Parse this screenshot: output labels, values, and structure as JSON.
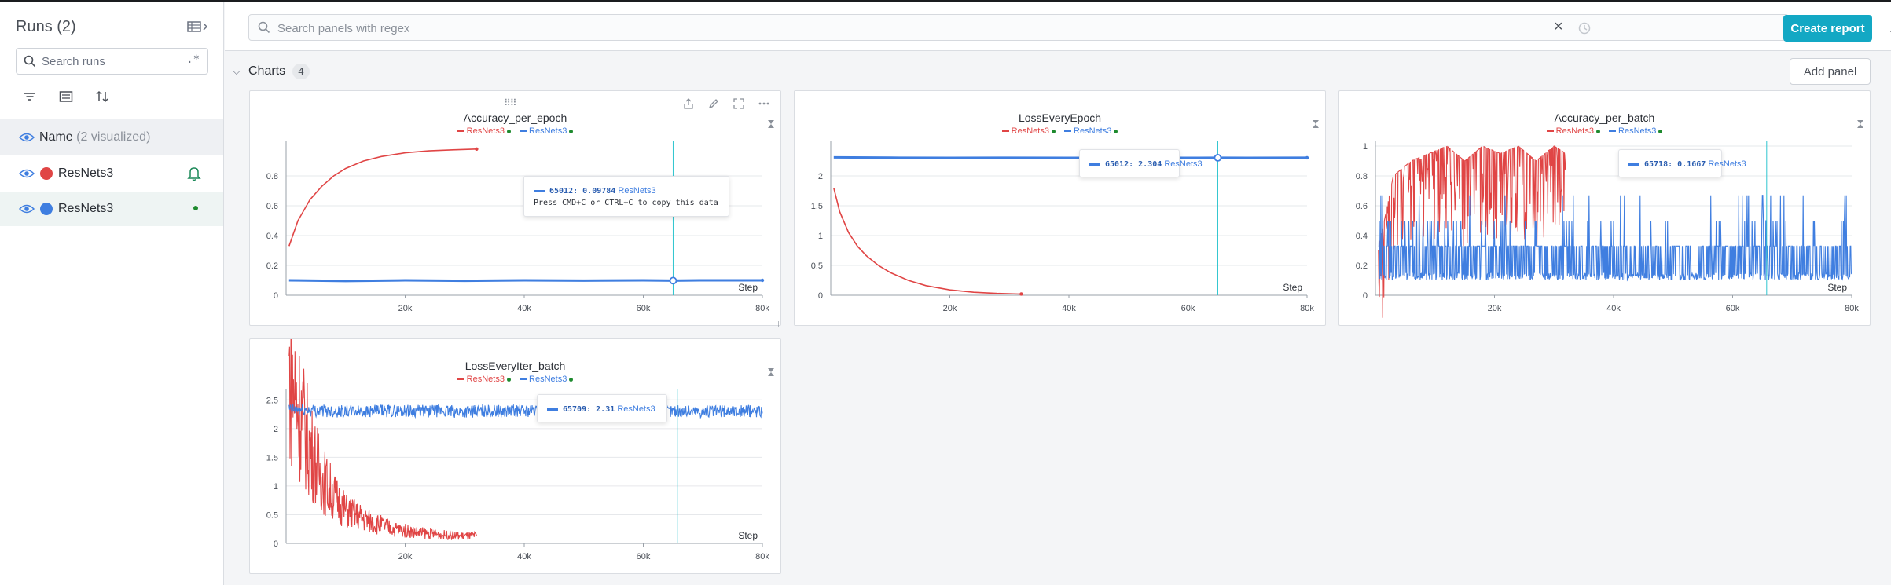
{
  "colors": {
    "accent": "#13a8c4",
    "run_red": "#e04545",
    "run_blue": "#3f7ee0",
    "status_green": "#1e8a2e",
    "cursor": "#2ec5cf"
  },
  "sidebar": {
    "title": "Runs (2)",
    "search_placeholder": "Search runs",
    "regex_label": ".*",
    "header_label": "Name",
    "header_count": "(2 visualized)",
    "runs": [
      {
        "name": "ResNets3",
        "color": "#e04545",
        "indicator": "bell-icon"
      },
      {
        "name": "ResNets3",
        "color": "#3f7ee0",
        "indicator": "green-dot"
      }
    ]
  },
  "topbar": {
    "search_placeholder": "Search panels with regex",
    "create_report_label": "Create report"
  },
  "section": {
    "title": "Charts",
    "count": "4",
    "add_panel_label": "Add panel"
  },
  "step_label": "Step",
  "legend_names": [
    "ResNets3",
    "ResNets3"
  ],
  "charts": [
    {
      "title": "Accuracy_per_epoch",
      "y_ticks": [
        "0",
        "0.2",
        "0.4",
        "0.6",
        "0.8"
      ],
      "x_ticks": [
        "20k",
        "40k",
        "60k",
        "80k"
      ],
      "tooltip": {
        "step": "65012",
        "value": "0.09784",
        "run": "ResNets3",
        "hint": "Press CMD+C or CTRL+C to copy this data"
      }
    },
    {
      "title": "LossEveryEpoch",
      "y_ticks": [
        "0",
        "0.5",
        "1",
        "1.5",
        "2"
      ],
      "x_ticks": [
        "20k",
        "40k",
        "60k",
        "80k"
      ],
      "tooltip": {
        "step": "65012",
        "value": "2.304",
        "run": "ResNets3"
      }
    },
    {
      "title": "Accuracy_per_batch",
      "y_ticks": [
        "0",
        "0.2",
        "0.4",
        "0.6",
        "0.8",
        "1"
      ],
      "x_ticks": [
        "20k",
        "40k",
        "60k",
        "80k"
      ],
      "tooltip": {
        "step": "65718",
        "value": "0.1667",
        "run": "ResNets3"
      }
    },
    {
      "title": "LossEveryIter_batch",
      "y_ticks": [
        "0",
        "0.5",
        "1",
        "1.5",
        "2",
        "2.5"
      ],
      "x_ticks": [
        "20k",
        "40k",
        "60k",
        "80k"
      ],
      "tooltip": {
        "step": "65709",
        "value": "2.31",
        "run": "ResNets3"
      }
    }
  ],
  "chart_data": [
    {
      "type": "line",
      "title": "Accuracy_per_epoch",
      "xlabel": "Step",
      "xlim": [
        0,
        80000
      ],
      "ylim": [
        0,
        1
      ],
      "series": [
        {
          "name": "ResNets3",
          "color": "#e04545",
          "x": [
            500,
            2000,
            4000,
            6000,
            8000,
            10000,
            13000,
            16000,
            20000,
            24000,
            28000,
            32000
          ],
          "y": [
            0.33,
            0.5,
            0.64,
            0.73,
            0.8,
            0.85,
            0.9,
            0.93,
            0.955,
            0.968,
            0.975,
            0.98
          ]
        },
        {
          "name": "ResNets3",
          "color": "#3f7ee0",
          "x": [
            500,
            10000,
            20000,
            30000,
            40000,
            50000,
            60000,
            65012,
            70000,
            80000
          ],
          "y": [
            0.1,
            0.095,
            0.1,
            0.097,
            0.1,
            0.098,
            0.1,
            0.09784,
            0.1,
            0.1
          ]
        }
      ]
    },
    {
      "type": "line",
      "title": "LossEveryEpoch",
      "xlabel": "Step",
      "xlim": [
        0,
        80000
      ],
      "ylim": [
        0,
        2.5
      ],
      "series": [
        {
          "name": "ResNets3",
          "color": "#e04545",
          "x": [
            500,
            1500,
            3000,
            4500,
            6000,
            8000,
            10000,
            13000,
            16000,
            20000,
            24000,
            28000,
            32000
          ],
          "y": [
            1.8,
            1.4,
            1.05,
            0.82,
            0.66,
            0.5,
            0.38,
            0.25,
            0.16,
            0.09,
            0.05,
            0.03,
            0.02
          ]
        },
        {
          "name": "ResNets3",
          "color": "#3f7ee0",
          "x": [
            500,
            10000,
            20000,
            30000,
            40000,
            50000,
            60000,
            65012,
            70000,
            80000
          ],
          "y": [
            2.31,
            2.305,
            2.303,
            2.304,
            2.303,
            2.304,
            2.303,
            2.304,
            2.303,
            2.304
          ]
        }
      ]
    },
    {
      "type": "line",
      "title": "Accuracy_per_batch",
      "xlabel": "Step",
      "xlim": [
        0,
        80000
      ],
      "ylim": [
        0,
        1
      ],
      "series": [
        {
          "name": "ResNets3",
          "color": "#e04545",
          "x": [
            500,
            3000,
            6000,
            9000,
            12000,
            15000,
            18000,
            21000,
            24000,
            27000,
            30000,
            32000
          ],
          "y": [
            0.3,
            0.8,
            0.9,
            0.95,
            1,
            0.9,
            1,
            0.95,
            1,
            0.9,
            1,
            0.95
          ]
        },
        {
          "name": "ResNets3",
          "color": "#3f7ee0",
          "x": [
            500,
            10000,
            20000,
            30000,
            40000,
            50000,
            60000,
            65718,
            70000,
            80000
          ],
          "y": [
            0.1,
            0.15,
            0.1,
            0.2,
            0.1,
            0.15,
            0.1,
            0.1667,
            0.1,
            0.15
          ]
        }
      ]
    },
    {
      "type": "line",
      "title": "LossEveryIter_batch",
      "xlabel": "Step",
      "xlim": [
        0,
        80000
      ],
      "ylim": [
        0,
        2.6
      ],
      "series": [
        {
          "name": "ResNets3",
          "color": "#e04545",
          "x": [
            500,
            2000,
            4000,
            6000,
            8000,
            10000,
            14000,
            18000,
            22000,
            26000,
            30000,
            32000
          ],
          "y": [
            2.3,
            1.9,
            1.3,
            0.9,
            0.65,
            0.45,
            0.3,
            0.2,
            0.15,
            0.12,
            0.1,
            0.1
          ]
        },
        {
          "name": "ResNets3",
          "color": "#3f7ee0",
          "x": [
            500,
            10000,
            20000,
            30000,
            40000,
            50000,
            60000,
            65709,
            70000,
            80000
          ],
          "y": [
            2.33,
            2.3,
            2.31,
            2.3,
            2.31,
            2.3,
            2.31,
            2.31,
            2.3,
            2.31
          ]
        }
      ]
    }
  ]
}
